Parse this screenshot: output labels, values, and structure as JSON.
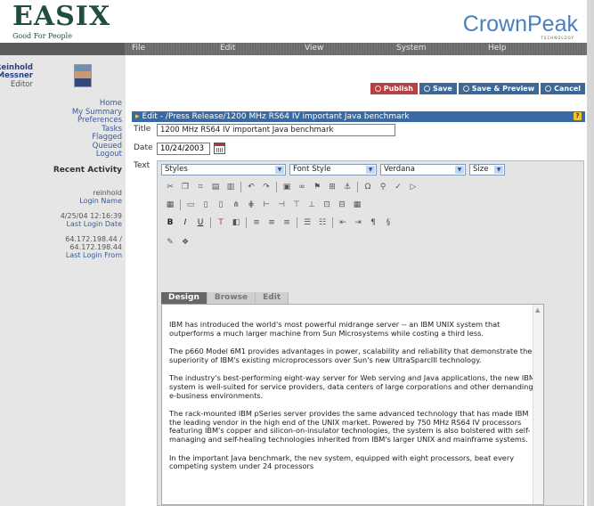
{
  "header": {
    "logo": "EASIX",
    "tagline": "Good For People",
    "brand": "CrownPeak",
    "brand_sub": "TECHNOLOGY"
  },
  "menu": [
    "File",
    "Edit",
    "View",
    "System",
    "Help"
  ],
  "user": {
    "name_line1": "Reinhold",
    "name_line2": "Messner",
    "role": "Editor"
  },
  "nav": [
    "Home",
    "My Summary",
    "Preferences",
    "Tasks",
    "Flagged",
    "Queued",
    "Logout"
  ],
  "recent": {
    "heading": "Recent Activity",
    "login_name": "reinhold",
    "login_name_label": "Login Name",
    "login_date": "4/25/04 12:16:39",
    "login_date_label": "Last Login Date",
    "login_from_1": "64.172.198.44 /",
    "login_from_2": "64.172.198.44",
    "login_from_label": "Last Login From"
  },
  "actions": {
    "publish": "Publish",
    "save": "Save",
    "save_preview": "Save & Preview",
    "cancel": "Cancel"
  },
  "edit_header": "Edit - /Press Release/1200 MHz RS64 IV important Java benchmark",
  "form": {
    "title_label": "Title",
    "title_value": "1200 MHz RS64 IV important Java benchmark",
    "date_label": "Date",
    "date_value": "10/24/2003",
    "text_label": "Text"
  },
  "editor": {
    "styles": "Styles",
    "font_style": "Font Style",
    "font": "Verdana",
    "size": "Size",
    "tabs": [
      "Design",
      "Browse",
      "Edit"
    ],
    "paragraphs": [
      "IBM has introduced the world's most powerful midrange server -- an IBM  UNIX system that outperforms a much larger machine from Sun Microsystems while costing a third less.",
      "The p660 Model 6M1 provides advantages in power, scalability and reliability that demonstrate the superiority of IBM's existing microprocessors over Sun's new UltraSparcIII technology.",
      "The industry's best-performing eight-way server for Web serving and Java applications, the new IBM system is well-suited for service providers, data centers of large corporations and other demanding e-business environments.",
      "The rack-mounted IBM  pSeries server provides the same advanced technology that has made IBM the leading vendor in the high end of the UNIX market. Powered by 750 MHz RS64 IV processors featuring IBM's copper and silicon-on-insulator technologies, the system is also bolstered with self-managing and self-healing technologies inherited from IBM's larger UNIX and mainframe systems.",
      "In the important Java benchmark, the nev system, equipped with eight processors, beat every competing system under 24 processors"
    ]
  }
}
